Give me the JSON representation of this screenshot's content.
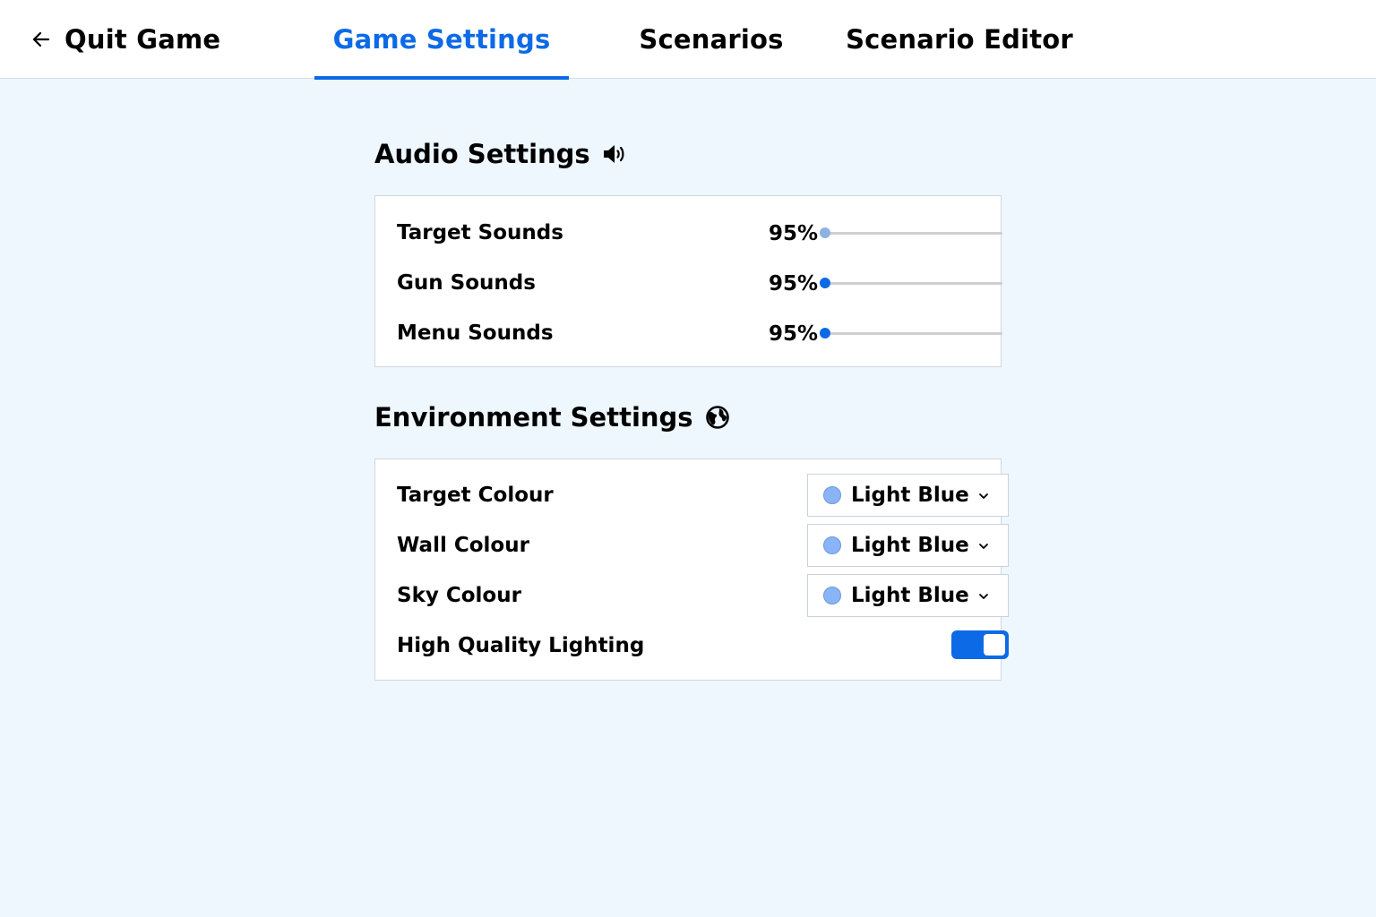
{
  "nav": {
    "quit_label": "Quit Game",
    "tabs": [
      {
        "label": "Game Settings",
        "active": true
      },
      {
        "label": "Scenarios",
        "active": false
      },
      {
        "label": "Scenario Editor",
        "active": false
      }
    ]
  },
  "audio": {
    "title": "Audio Settings",
    "icon": "speaker-icon",
    "rows": [
      {
        "label": "Target Sounds",
        "value_text": "95%"
      },
      {
        "label": "Gun Sounds",
        "value_text": "95%"
      },
      {
        "label": "Menu Sounds",
        "value_text": "95%"
      }
    ]
  },
  "environment": {
    "title": "Environment Settings",
    "icon": "globe-icon",
    "rows": [
      {
        "label": "Target Colour",
        "value": "Light Blue",
        "swatch": "#8ab4f8"
      },
      {
        "label": "Wall Colour",
        "value": "Light Blue",
        "swatch": "#8ab4f8"
      },
      {
        "label": "Sky Colour",
        "value": "Light Blue",
        "swatch": "#8ab4f8"
      }
    ],
    "lighting": {
      "label": "High Quality Lighting",
      "enabled": true
    }
  },
  "colors": {
    "accent": "#0d6ae6",
    "background": "#eef6fe",
    "muted_thumb": "#8fb1e2"
  }
}
